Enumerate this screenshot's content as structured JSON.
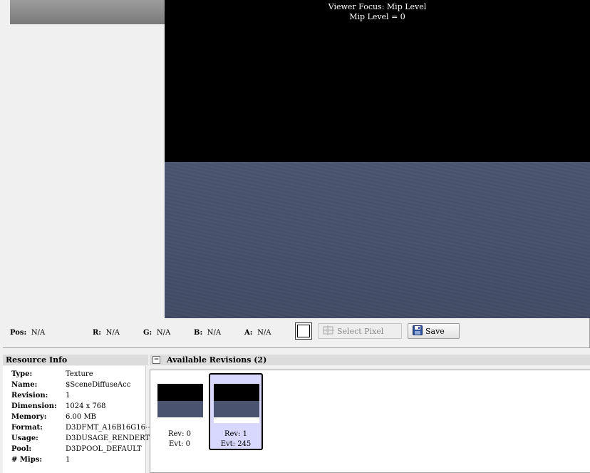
{
  "viewer": {
    "overlay_line1": "Viewer Focus: Mip Level",
    "overlay_line2": "Mip Level = 0"
  },
  "pixel_info": {
    "pos_label": "Pos:",
    "pos_value": "N/A",
    "r_label": "R:",
    "r_value": "N/A",
    "g_label": "G:",
    "g_value": "N/A",
    "b_label": "B:",
    "b_value": "N/A",
    "a_label": "A:",
    "a_value": "N/A",
    "swatch_color": "#ffffff",
    "select_pixel_label": "Select Pixel",
    "save_label": "Save"
  },
  "resource_info": {
    "header": "Resource Info",
    "rows": [
      {
        "key": "Type:",
        "value": "Texture"
      },
      {
        "key": "Name:",
        "value": "$SceneDiffuseAcc"
      },
      {
        "key": "Revision:",
        "value": "1"
      },
      {
        "key": "Dimension:",
        "value": "1024 x 768"
      },
      {
        "key": "Memory:",
        "value": "6.00 MB"
      },
      {
        "key": "Format:",
        "value": "D3DFMT_A16B16G16⋯"
      },
      {
        "key": "Usage:",
        "value": "D3DUSAGE_RENDERT⋯"
      },
      {
        "key": "Pool:",
        "value": "D3DPOOL_DEFAULT"
      },
      {
        "key": "# Mips:",
        "value": "1"
      }
    ]
  },
  "revisions": {
    "header": "Available Revisions (2)",
    "collapse_glyph": "−",
    "items": [
      {
        "rev": "Rev: 0",
        "evt": "Evt: 0",
        "selected": false
      },
      {
        "rev": "Rev: 1",
        "evt": "Evt: 245",
        "selected": true
      }
    ]
  },
  "colors": {
    "selected_revision_bg": "#d8d8ff",
    "viewer_top": "#000000",
    "viewer_bottom": "#4b5570"
  }
}
